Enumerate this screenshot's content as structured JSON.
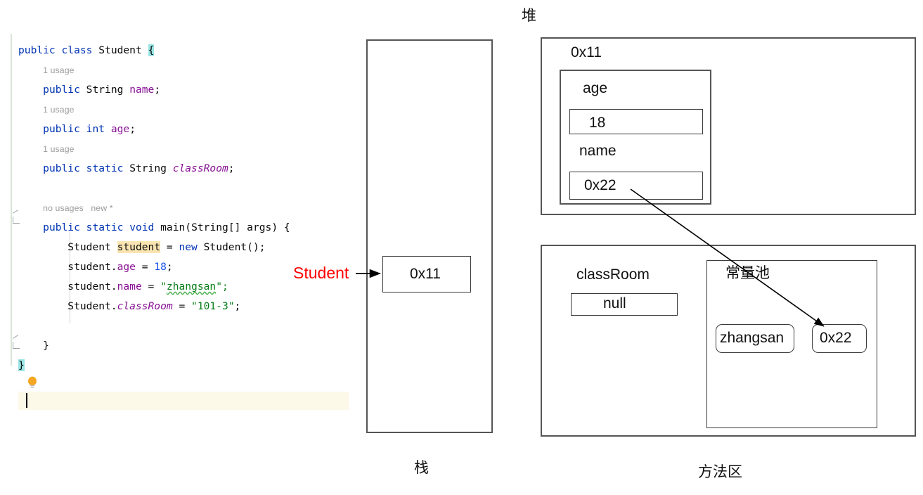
{
  "editor": {
    "lines": [
      {
        "kind": "code",
        "indent": 0,
        "tokens": [
          {
            "t": "public",
            "c": "kw"
          },
          {
            "t": " ",
            "c": "plain"
          },
          {
            "t": "class",
            "c": "kw"
          },
          {
            "t": " ",
            "c": "plain"
          },
          {
            "t": "Student",
            "c": "type"
          },
          {
            "t": " ",
            "c": "plain"
          },
          {
            "t": "{",
            "c": "brace-hl"
          }
        ]
      },
      {
        "kind": "hint",
        "indent": 1,
        "text": "1 usage"
      },
      {
        "kind": "code",
        "indent": 1,
        "tokens": [
          {
            "t": "public",
            "c": "kw"
          },
          {
            "t": " ",
            "c": "plain"
          },
          {
            "t": "String",
            "c": "type"
          },
          {
            "t": " ",
            "c": "plain"
          },
          {
            "t": "name",
            "c": "field"
          },
          {
            "t": ";",
            "c": "plain"
          }
        ]
      },
      {
        "kind": "hint",
        "indent": 1,
        "text": "1 usage"
      },
      {
        "kind": "code",
        "indent": 1,
        "tokens": [
          {
            "t": "public",
            "c": "kw"
          },
          {
            "t": " ",
            "c": "plain"
          },
          {
            "t": "int",
            "c": "kw"
          },
          {
            "t": " ",
            "c": "plain"
          },
          {
            "t": "age",
            "c": "field"
          },
          {
            "t": ";",
            "c": "plain"
          }
        ]
      },
      {
        "kind": "hint",
        "indent": 1,
        "text": "1 usage"
      },
      {
        "kind": "code",
        "indent": 1,
        "tokens": [
          {
            "t": "public",
            "c": "kw"
          },
          {
            "t": " ",
            "c": "plain"
          },
          {
            "t": "static",
            "c": "kw"
          },
          {
            "t": " ",
            "c": "plain"
          },
          {
            "t": "String",
            "c": "type"
          },
          {
            "t": " ",
            "c": "plain"
          },
          {
            "t": "classRoom",
            "c": "sfield"
          },
          {
            "t": ";",
            "c": "plain"
          }
        ]
      },
      {
        "kind": "blank"
      },
      {
        "kind": "hint",
        "indent": 1,
        "text": "no usages   new *"
      },
      {
        "kind": "code",
        "indent": 1,
        "tokens": [
          {
            "t": "public",
            "c": "kw"
          },
          {
            "t": " ",
            "c": "plain"
          },
          {
            "t": "static",
            "c": "kw"
          },
          {
            "t": " ",
            "c": "plain"
          },
          {
            "t": "void",
            "c": "kw"
          },
          {
            "t": " ",
            "c": "plain"
          },
          {
            "t": "main",
            "c": "type"
          },
          {
            "t": "(",
            "c": "plain"
          },
          {
            "t": "String",
            "c": "type"
          },
          {
            "t": "[] ",
            "c": "plain"
          },
          {
            "t": "args",
            "c": "type"
          },
          {
            "t": ") {",
            "c": "plain"
          }
        ]
      },
      {
        "kind": "code",
        "indent": 2,
        "tokens": [
          {
            "t": "Student",
            "c": "type"
          },
          {
            "t": " ",
            "c": "plain"
          },
          {
            "t": "student",
            "c": "ident-hl"
          },
          {
            "t": " = ",
            "c": "plain"
          },
          {
            "t": "new",
            "c": "kw"
          },
          {
            "t": " ",
            "c": "plain"
          },
          {
            "t": "Student",
            "c": "type"
          },
          {
            "t": "();",
            "c": "plain"
          }
        ]
      },
      {
        "kind": "code",
        "indent": 2,
        "tokens": [
          {
            "t": "student.",
            "c": "plain"
          },
          {
            "t": "age",
            "c": "field"
          },
          {
            "t": " = ",
            "c": "plain"
          },
          {
            "t": "18",
            "c": "num"
          },
          {
            "t": ";",
            "c": "plain"
          }
        ]
      },
      {
        "kind": "code",
        "indent": 2,
        "tokens": [
          {
            "t": "student.",
            "c": "plain"
          },
          {
            "t": "name",
            "c": "field"
          },
          {
            "t": " = ",
            "c": "plain"
          },
          {
            "t": "\"",
            "c": "str"
          },
          {
            "t": "zhangsan",
            "c": "str typo"
          },
          {
            "t": "\";",
            "c": "str"
          }
        ]
      },
      {
        "kind": "code",
        "indent": 2,
        "tokens": [
          {
            "t": "Student.",
            "c": "plain"
          },
          {
            "t": "classRoom",
            "c": "sfield"
          },
          {
            "t": " = ",
            "c": "plain"
          },
          {
            "t": "\"101-3\"",
            "c": "str"
          },
          {
            "t": ";",
            "c": "plain"
          }
        ]
      },
      {
        "kind": "blank"
      },
      {
        "kind": "code",
        "indent": 1,
        "tokens": [
          {
            "t": "}",
            "c": "plain"
          }
        ]
      },
      {
        "kind": "code",
        "indent": 0,
        "tokens": [
          {
            "t": "}",
            "c": "brace-hl"
          }
        ]
      }
    ]
  },
  "diagram": {
    "stack": {
      "region_label": "栈",
      "reference_label": "Student",
      "slot_value": "0x11"
    },
    "heap": {
      "region_label": "堆",
      "object_address": "0x11",
      "fields": [
        {
          "name": "age",
          "value": "18"
        },
        {
          "name": "name",
          "value": "0x22"
        }
      ]
    },
    "method_area": {
      "region_label": "方法区",
      "static_field": {
        "name": "classRoom",
        "value": "null"
      },
      "constant_pool": {
        "label": "常量池",
        "entries": [
          "zhangsan",
          "0x22"
        ]
      }
    }
  },
  "colors": {
    "keyword": "#0033B3",
    "field": "#871094",
    "string": "#067D17",
    "number": "#1750EB",
    "reference_label": "#FF0000",
    "brace_highlight": "#99E4E4",
    "identifier_highlight": "#FAE5B2",
    "box_border": "#555555",
    "hint_text": "#9B9B9B"
  }
}
